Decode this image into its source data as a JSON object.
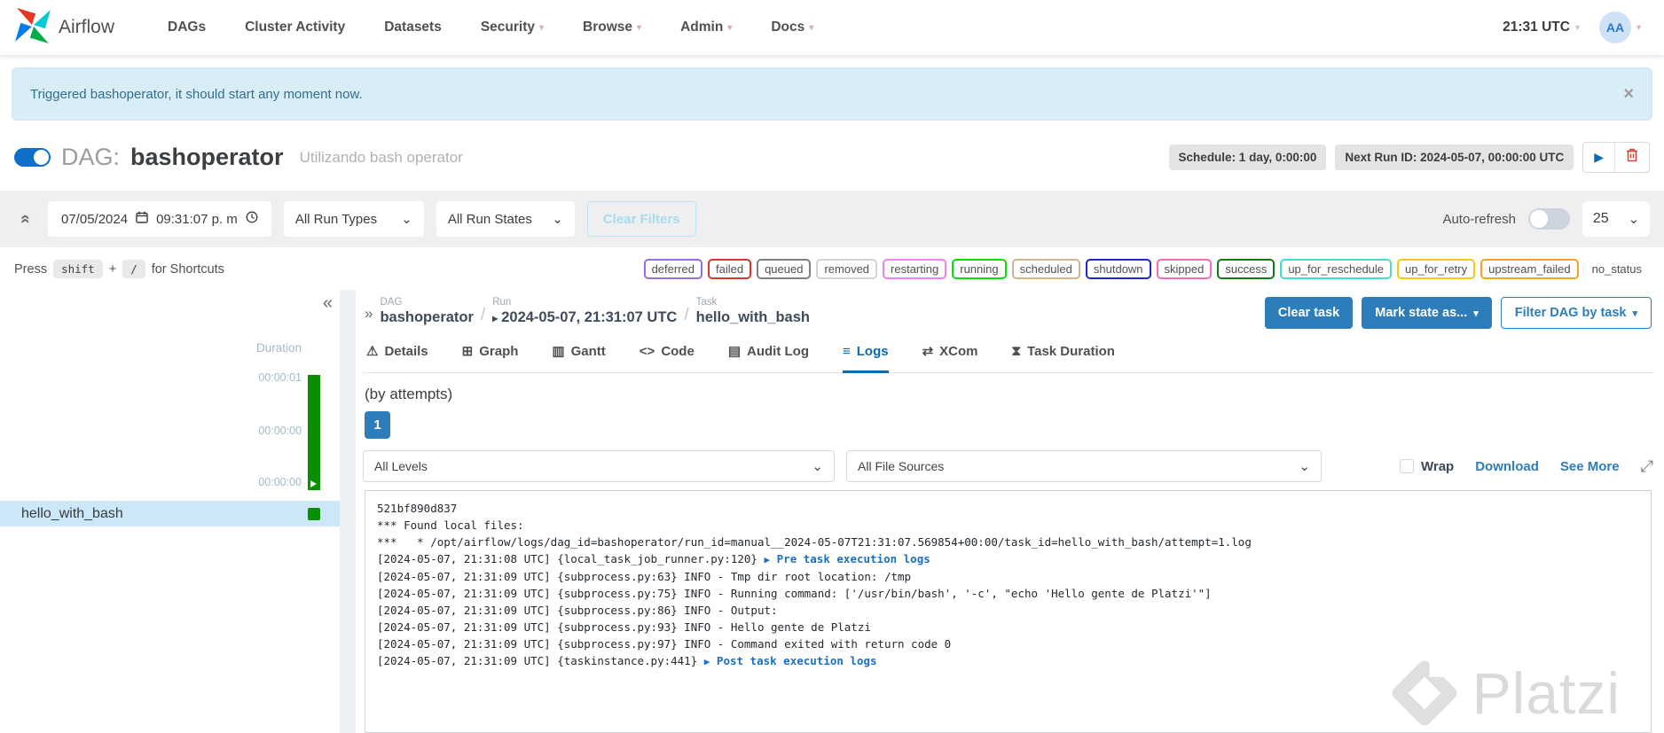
{
  "navbar": {
    "brand": "Airflow",
    "items": [
      {
        "label": "DAGs",
        "caret": false
      },
      {
        "label": "Cluster Activity",
        "caret": false
      },
      {
        "label": "Datasets",
        "caret": false
      },
      {
        "label": "Security",
        "caret": true
      },
      {
        "label": "Browse",
        "caret": true
      },
      {
        "label": "Admin",
        "caret": true
      },
      {
        "label": "Docs",
        "caret": true
      }
    ],
    "clock": "21:31 UTC",
    "avatar_initials": "AA"
  },
  "icons": {
    "caret_down": "▾",
    "chevron_down": "⌄",
    "collapse_double": "«",
    "expand_double": "»",
    "play": "▶",
    "run_expand": "▸",
    "close": "×",
    "fullscreen": "⤢",
    "plus": "+"
  },
  "alert": {
    "message": "Triggered bashoperator, it should start any moment now."
  },
  "dag_header": {
    "prefix": "DAG:",
    "name": "bashoperator",
    "description": "Utilizando bash operator",
    "schedule_badge": "Schedule: 1 day, 0:00:00",
    "next_run_badge": "Next Run ID: 2024-05-07, 00:00:00 UTC"
  },
  "filter_bar": {
    "date": "07/05/2024",
    "time": "09:31:07 p. m",
    "run_types": "All Run Types",
    "run_states": "All Run States",
    "clear_filters": "Clear Filters",
    "auto_refresh_label": "Auto-refresh",
    "page_size": "25"
  },
  "shortcuts": {
    "press": "Press",
    "key1": "shift",
    "plus": "+",
    "key2": "/",
    "suffix": "for Shortcuts"
  },
  "status_badges": [
    {
      "label": "deferred",
      "color": "#9370db"
    },
    {
      "label": "failed",
      "color": "#e0302f"
    },
    {
      "label": "queued",
      "color": "#808080"
    },
    {
      "label": "removed",
      "color": "#d3d3d3"
    },
    {
      "label": "restarting",
      "color": "#ee82ee"
    },
    {
      "label": "running",
      "color": "#00e400"
    },
    {
      "label": "scheduled",
      "color": "#d2b48c"
    },
    {
      "label": "shutdown",
      "color": "#2222dd"
    },
    {
      "label": "skipped",
      "color": "#ff69b4"
    },
    {
      "label": "success",
      "color": "#107c10"
    },
    {
      "label": "up_for_reschedule",
      "color": "#40e0d0"
    },
    {
      "label": "up_for_retry",
      "color": "#f3cb0c"
    },
    {
      "label": "upstream_failed",
      "color": "#f0a420"
    },
    {
      "label": "no_status",
      "color": "transparent"
    }
  ],
  "grid_panel": {
    "duration_label": "Duration",
    "ticks": [
      "00:00:01",
      "00:00:00",
      "00:00:00"
    ],
    "task_name": "hello_with_bash"
  },
  "breadcrumb": {
    "dag_label": "DAG",
    "dag_value": "bashoperator",
    "run_label": "Run",
    "run_value": "2024-05-07, 21:31:07 UTC",
    "task_label": "Task",
    "task_value": "hello_with_bash"
  },
  "actions": {
    "clear_task": "Clear task",
    "mark_state": "Mark state as...",
    "filter_dag": "Filter DAG by task"
  },
  "tabs": [
    {
      "icon": "⚠",
      "label": "Details",
      "active": false
    },
    {
      "icon": "⊞",
      "label": "Graph",
      "active": false
    },
    {
      "icon": "▥",
      "label": "Gantt",
      "active": false
    },
    {
      "icon": "<>",
      "label": "Code",
      "active": false
    },
    {
      "icon": "▤",
      "label": "Audit Log",
      "active": false
    },
    {
      "icon": "≡",
      "label": "Logs",
      "active": true
    },
    {
      "icon": "⇄",
      "label": "XCom",
      "active": false
    },
    {
      "icon": "⧗",
      "label": "Task Duration",
      "active": false
    }
  ],
  "logs_section": {
    "by_attempts": "(by attempts)",
    "attempt": "1",
    "level_filter": "All Levels",
    "source_filter": "All File Sources",
    "wrap_label": "Wrap",
    "download_label": "Download",
    "see_more_label": "See More",
    "log_lines": [
      {
        "pre": "521bf890d837"
      },
      {
        "pre": "*** Found local files:"
      },
      {
        "pre": "***   * /opt/airflow/logs/dag_id=bashoperator/run_id=manual__2024-05-07T21:31:07.569854+00:00/task_id=hello_with_bash/attempt=1.log"
      },
      {
        "pre": "[2024-05-07, 21:31:08 UTC] {local_task_job_runner.py:120} ",
        "link": "Pre task execution logs"
      },
      {
        "pre": "[2024-05-07, 21:31:09 UTC] {subprocess.py:63} INFO - Tmp dir root location: /tmp"
      },
      {
        "pre": "[2024-05-07, 21:31:09 UTC] {subprocess.py:75} INFO - Running command: ['/usr/bin/bash', '-c', \"echo 'Hello gente de Platzi'\"]"
      },
      {
        "pre": "[2024-05-07, 21:31:09 UTC] {subprocess.py:86} INFO - Output:"
      },
      {
        "pre": "[2024-05-07, 21:31:09 UTC] {subprocess.py:93} INFO - Hello gente de Platzi"
      },
      {
        "pre": "[2024-05-07, 21:31:09 UTC] {subprocess.py:97} INFO - Command exited with return code 0"
      },
      {
        "pre": "[2024-05-07, 21:31:09 UTC] {taskinstance.py:441} ",
        "link": "Post task execution logs"
      }
    ]
  },
  "watermark": {
    "text": "Platzi"
  },
  "colors": {
    "accent_blue": "#2d7dbb",
    "active_tab_blue": "#0b6cad",
    "alert_bg": "#d9edf7",
    "success_green": "#089000",
    "selected_row_bg": "#cbe7f8"
  }
}
